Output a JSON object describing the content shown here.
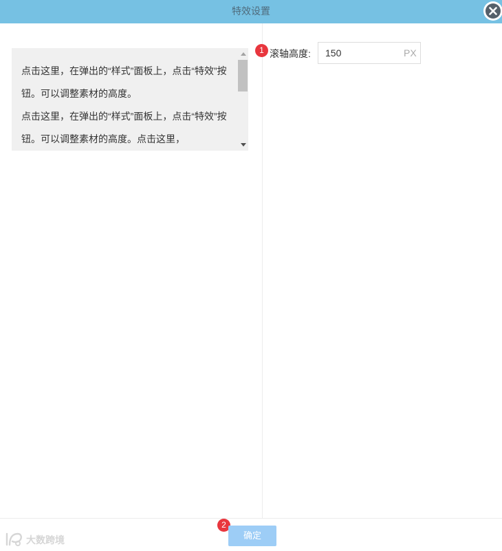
{
  "dialog": {
    "title": "特效设置"
  },
  "preview": {
    "paragraphs": [
      "点击这里，在弹出的“样式”面板上，点击“特效”按钮。可以调整素材的高度。",
      "点击这里，在弹出的“样式”面板上，点击“特效”按钮。可以调整素材的高度。点击这里，"
    ]
  },
  "settings": {
    "scroll_height_label": "滚轴高度:",
    "scroll_height_value": "150",
    "unit": "PX"
  },
  "badges": {
    "one": "1",
    "two": "2"
  },
  "footer": {
    "confirm_label": "确定"
  },
  "watermark": {
    "text": "大数跨境"
  },
  "colors": {
    "titlebar": "#76c1e3",
    "badge": "#e8363e",
    "confirm_button": "#9dcdf6"
  },
  "icons": [
    "close-icon",
    "scroll-up-arrow-icon",
    "scroll-down-arrow-icon",
    "watermark-logo-icon"
  ]
}
